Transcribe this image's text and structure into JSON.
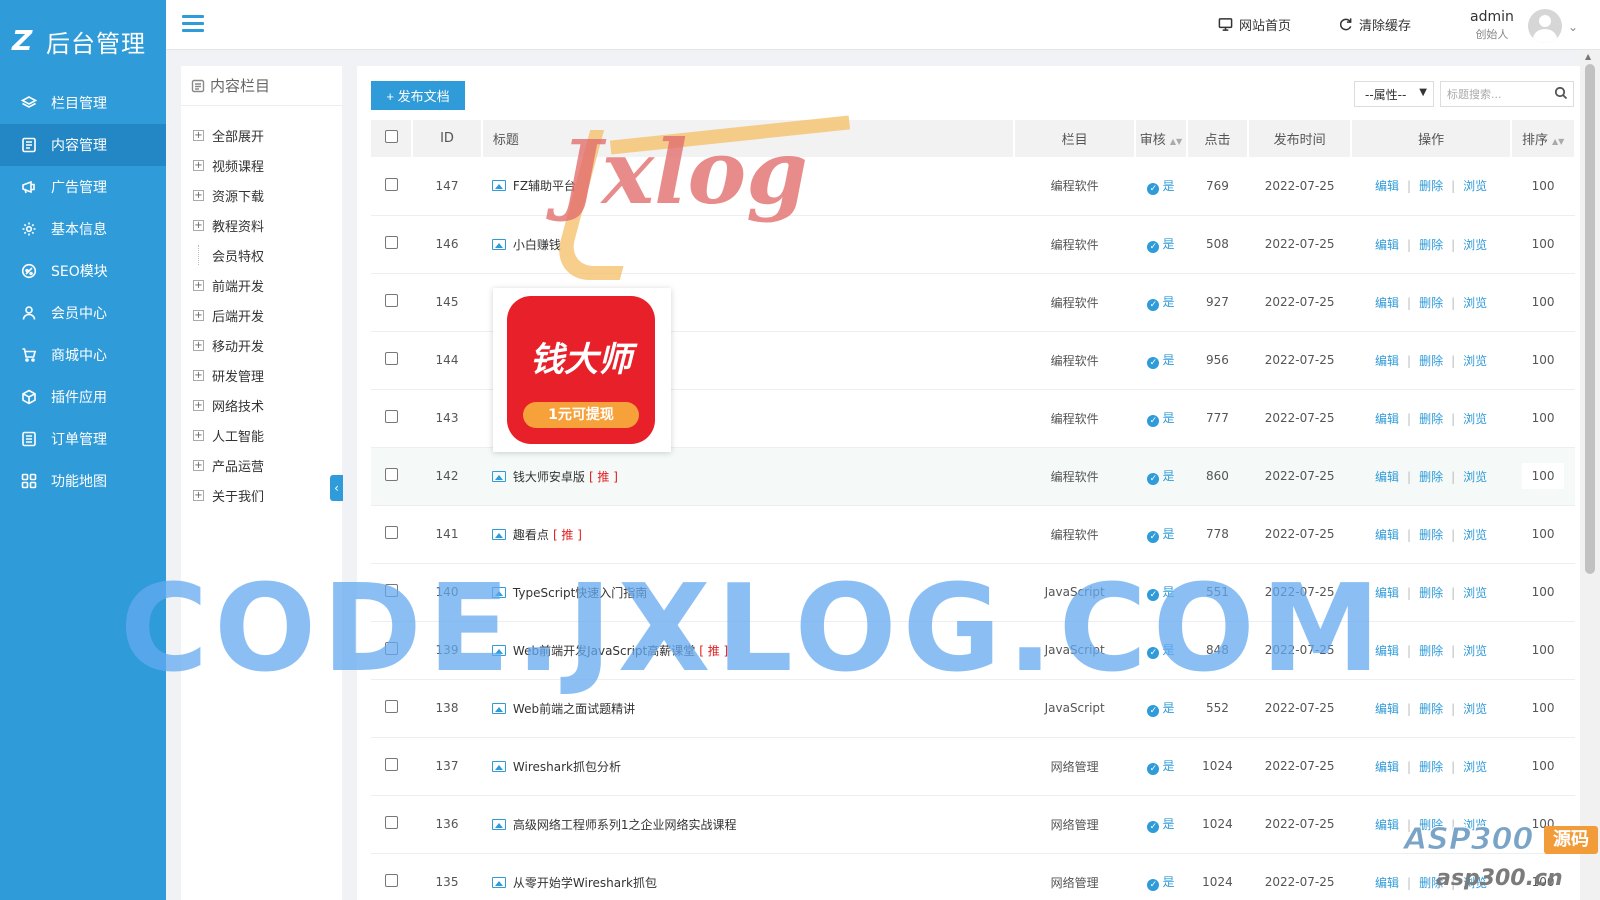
{
  "brand": {
    "logo_mark": "Z",
    "logo_text": "后台管理"
  },
  "sidebar": {
    "items": [
      {
        "label": "栏目管理",
        "icon": "layers-icon"
      },
      {
        "label": "内容管理",
        "icon": "document-icon",
        "active": true
      },
      {
        "label": "广告管理",
        "icon": "ad-icon"
      },
      {
        "label": "基本信息",
        "icon": "gear-icon"
      },
      {
        "label": "SEO模块",
        "icon": "seo-icon"
      },
      {
        "label": "会员中心",
        "icon": "user-icon"
      },
      {
        "label": "商城中心",
        "icon": "cart-icon"
      },
      {
        "label": "插件应用",
        "icon": "cube-icon"
      },
      {
        "label": "订单管理",
        "icon": "list-icon"
      },
      {
        "label": "功能地图",
        "icon": "grid-icon"
      }
    ]
  },
  "topbar": {
    "home_label": "网站首页",
    "clear_cache_label": "清除缓存",
    "user_name": "admin",
    "user_role": "创始人"
  },
  "tree": {
    "title": "内容栏目",
    "items": [
      {
        "label": "全部展开",
        "child": false
      },
      {
        "label": "视频课程",
        "child": false
      },
      {
        "label": "资源下载",
        "child": false
      },
      {
        "label": "教程资料",
        "child": false
      },
      {
        "label": "会员特权",
        "child": true
      },
      {
        "label": "前端开发",
        "child": false
      },
      {
        "label": "后端开发",
        "child": false
      },
      {
        "label": "移动开发",
        "child": false
      },
      {
        "label": "研发管理",
        "child": false
      },
      {
        "label": "网络技术",
        "child": false
      },
      {
        "label": "人工智能",
        "child": false
      },
      {
        "label": "产品运营",
        "child": false
      },
      {
        "label": "关于我们",
        "child": false
      }
    ],
    "collapse_arrow": "‹"
  },
  "toolbar": {
    "publish_label": "+ 发布文档",
    "attr_select_value": "--属性--",
    "search_placeholder": "标题搜索..."
  },
  "table": {
    "headers": {
      "id": "ID",
      "title": "标题",
      "category": "栏目",
      "audit": "审核",
      "hits": "点击",
      "date": "发布时间",
      "ops": "操作",
      "sort": "排序"
    },
    "op_labels": {
      "edit": "编辑",
      "delete": "删除",
      "view": "浏览"
    },
    "rows": [
      {
        "id": "147",
        "title": "FZ辅助平台",
        "tag": "",
        "category": "编程软件",
        "audit": "是",
        "hits": "769",
        "date": "2022-07-25",
        "sort": "100"
      },
      {
        "id": "146",
        "title": "小白赚钱",
        "tag": "",
        "category": "编程软件",
        "audit": "是",
        "hits": "508",
        "date": "2022-07-25",
        "sort": "100"
      },
      {
        "id": "145",
        "title": "",
        "tag": "",
        "category": "编程软件",
        "audit": "是",
        "hits": "927",
        "date": "2022-07-25",
        "sort": "100"
      },
      {
        "id": "144",
        "title": "",
        "tag": "",
        "category": "编程软件",
        "audit": "是",
        "hits": "956",
        "date": "2022-07-25",
        "sort": "100"
      },
      {
        "id": "143",
        "title": "",
        "tag": "",
        "category": "编程软件",
        "audit": "是",
        "hits": "777",
        "date": "2022-07-25",
        "sort": "100"
      },
      {
        "id": "142",
        "title": "钱大师安卓版",
        "tag": "[ 推 ]",
        "category": "编程软件",
        "audit": "是",
        "hits": "860",
        "date": "2022-07-25",
        "sort": "100",
        "highlight": true
      },
      {
        "id": "141",
        "title": "趣看点",
        "tag": "[ 推 ]",
        "category": "编程软件",
        "audit": "是",
        "hits": "778",
        "date": "2022-07-25",
        "sort": "100"
      },
      {
        "id": "140",
        "title": "TypeScript快速入门指南",
        "tag": "",
        "category": "JavaScript",
        "audit": "是",
        "hits": "551",
        "date": "2022-07-25",
        "sort": "100"
      },
      {
        "id": "139",
        "title": "Web前端开发JavaScript高薪课堂",
        "tag": "[ 推 ]",
        "category": "JavaScript",
        "audit": "是",
        "hits": "848",
        "date": "2022-07-25",
        "sort": "100"
      },
      {
        "id": "138",
        "title": "Web前端之面试题精讲",
        "tag": "",
        "category": "JavaScript",
        "audit": "是",
        "hits": "552",
        "date": "2022-07-25",
        "sort": "100"
      },
      {
        "id": "137",
        "title": "Wireshark抓包分析",
        "tag": "",
        "category": "网络管理",
        "audit": "是",
        "hits": "1024",
        "date": "2022-07-25",
        "sort": "100"
      },
      {
        "id": "136",
        "title": "高级网络工程师系列1之企业网络实战课程",
        "tag": "",
        "category": "网络管理",
        "audit": "是",
        "hits": "1024",
        "date": "2022-07-25",
        "sort": "100"
      },
      {
        "id": "135",
        "title": "从零开始学Wireshark抓包",
        "tag": "",
        "category": "网络管理",
        "audit": "是",
        "hits": "1024",
        "date": "2022-07-25",
        "sort": "100"
      }
    ]
  },
  "overlays": {
    "watermark_big": "CODE.JXLOG.COM",
    "watermark_logo": "Jxlog",
    "app_popup_name": "钱大师",
    "app_popup_badge": "1元可提现",
    "asp_logo_main": "ASP300",
    "asp_logo_tag": "源码",
    "asp_logo_url": "asp300.cn"
  },
  "colors": {
    "primary": "#2f9bd9",
    "sidebar_active": "#2387c6",
    "tag_red": "#e02020"
  }
}
